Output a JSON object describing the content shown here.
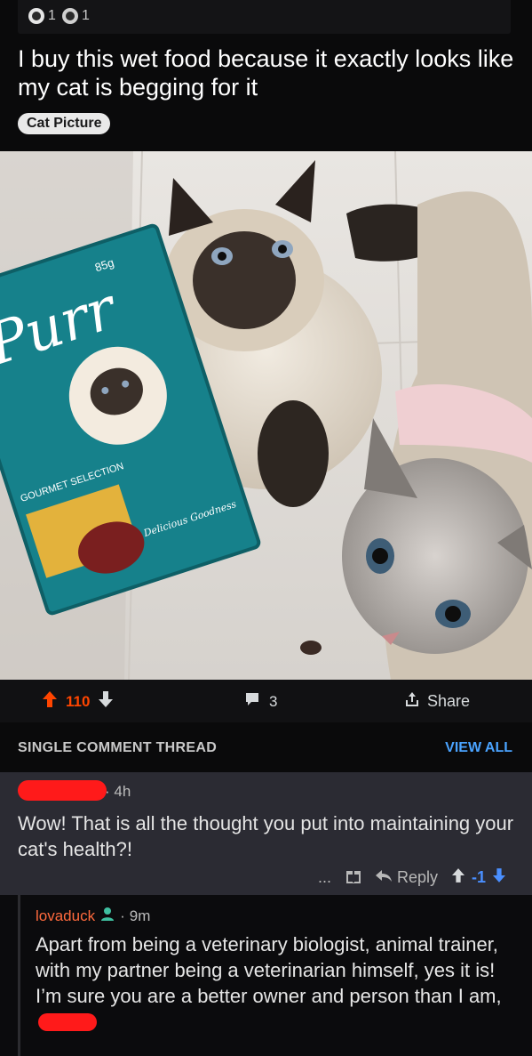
{
  "awards": [
    {
      "icon": "award-icon",
      "count": "1"
    },
    {
      "icon": "gold-award-icon",
      "count": "1"
    }
  ],
  "post": {
    "title": "I buy this wet food because it exactly looks like my cat is begging for it",
    "flair": "Cat Picture",
    "image": {
      "pouch_weight": "85g",
      "pouch_brand": "Purr",
      "pouch_line": "GOURMET SELECTION",
      "pouch_tagline": "Delicious Goodness"
    }
  },
  "actions": {
    "score": "110",
    "comment_count": "3",
    "share_label": "Share"
  },
  "thread": {
    "label": "SINGLE COMMENT THREAD",
    "view_all": "VIEW ALL"
  },
  "comment1": {
    "age": "4h",
    "text": "Wow! That is all the thought you put into maintaining your cat's health?!",
    "more": "...",
    "reply_label": "Reply",
    "score": "-1"
  },
  "comment2": {
    "username": "lovaduck",
    "age": "9m",
    "text": "Apart from being a veterinary biologist, animal trainer, with my partner being a veterinarian himself, yes it is! I’m sure you are a better owner and person than I am,"
  },
  "colors": {
    "upvote": "#ff4500",
    "downvote": "#4a8fff",
    "link": "#4aa3ff",
    "redaction": "#ff1a1a",
    "username": "#ff6a3d"
  }
}
